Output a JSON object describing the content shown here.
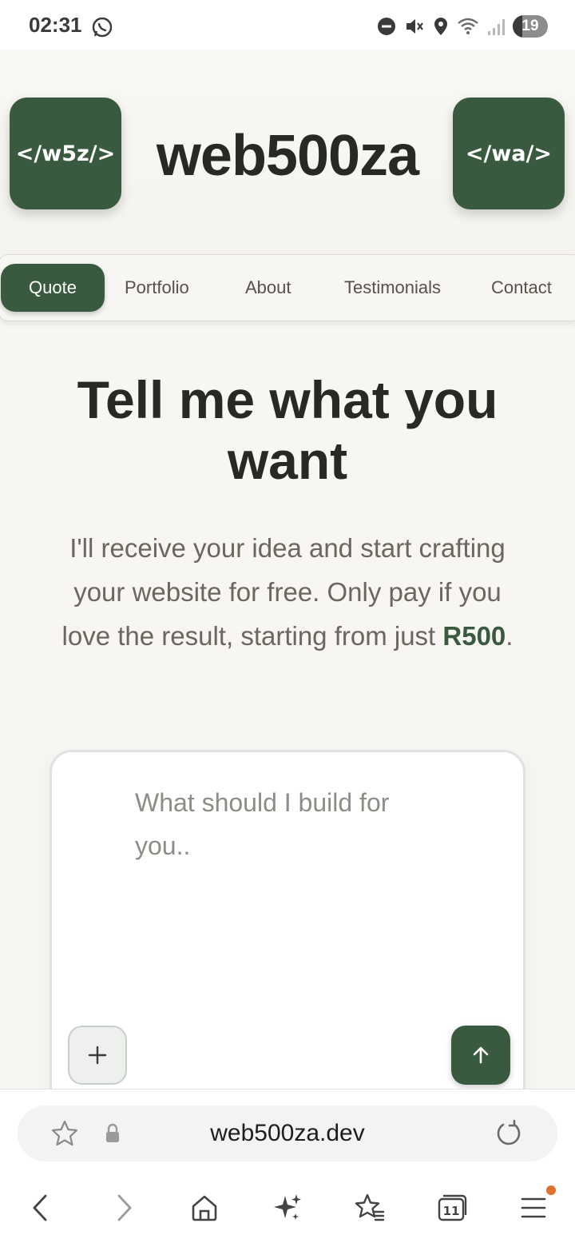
{
  "status_bar": {
    "time": "02:31",
    "battery": "19",
    "icons": [
      "whatsapp-icon",
      "do-not-disturb-icon",
      "mute-icon",
      "location-icon",
      "wifi-icon",
      "signal-icon",
      "battery-icon"
    ]
  },
  "header": {
    "logo_left": "</w5z/>",
    "brand": "web500za",
    "logo_right": "</wa/>"
  },
  "nav": {
    "items": [
      {
        "label": "Quote",
        "active": true
      },
      {
        "label": "Portfolio",
        "active": false
      },
      {
        "label": "About",
        "active": false
      },
      {
        "label": "Testimonials",
        "active": false
      },
      {
        "label": "Contact",
        "active": false
      }
    ]
  },
  "hero": {
    "headline": "Tell me what you want",
    "lead_text": "I'll receive your idea and start crafting your website for free. Only pay if you love the result, starting from just ",
    "price": "R500",
    "lead_end": "."
  },
  "prompt": {
    "placeholder": "What should I build for you..",
    "value": ""
  },
  "browser": {
    "url": "web500za.dev",
    "tab_count": "11"
  },
  "colors": {
    "accent": "#3a5a40",
    "background": "#f7f6f2",
    "text": "#2a2824",
    "muted_text": "#6b665e",
    "notification_dot": "#e0702e"
  }
}
